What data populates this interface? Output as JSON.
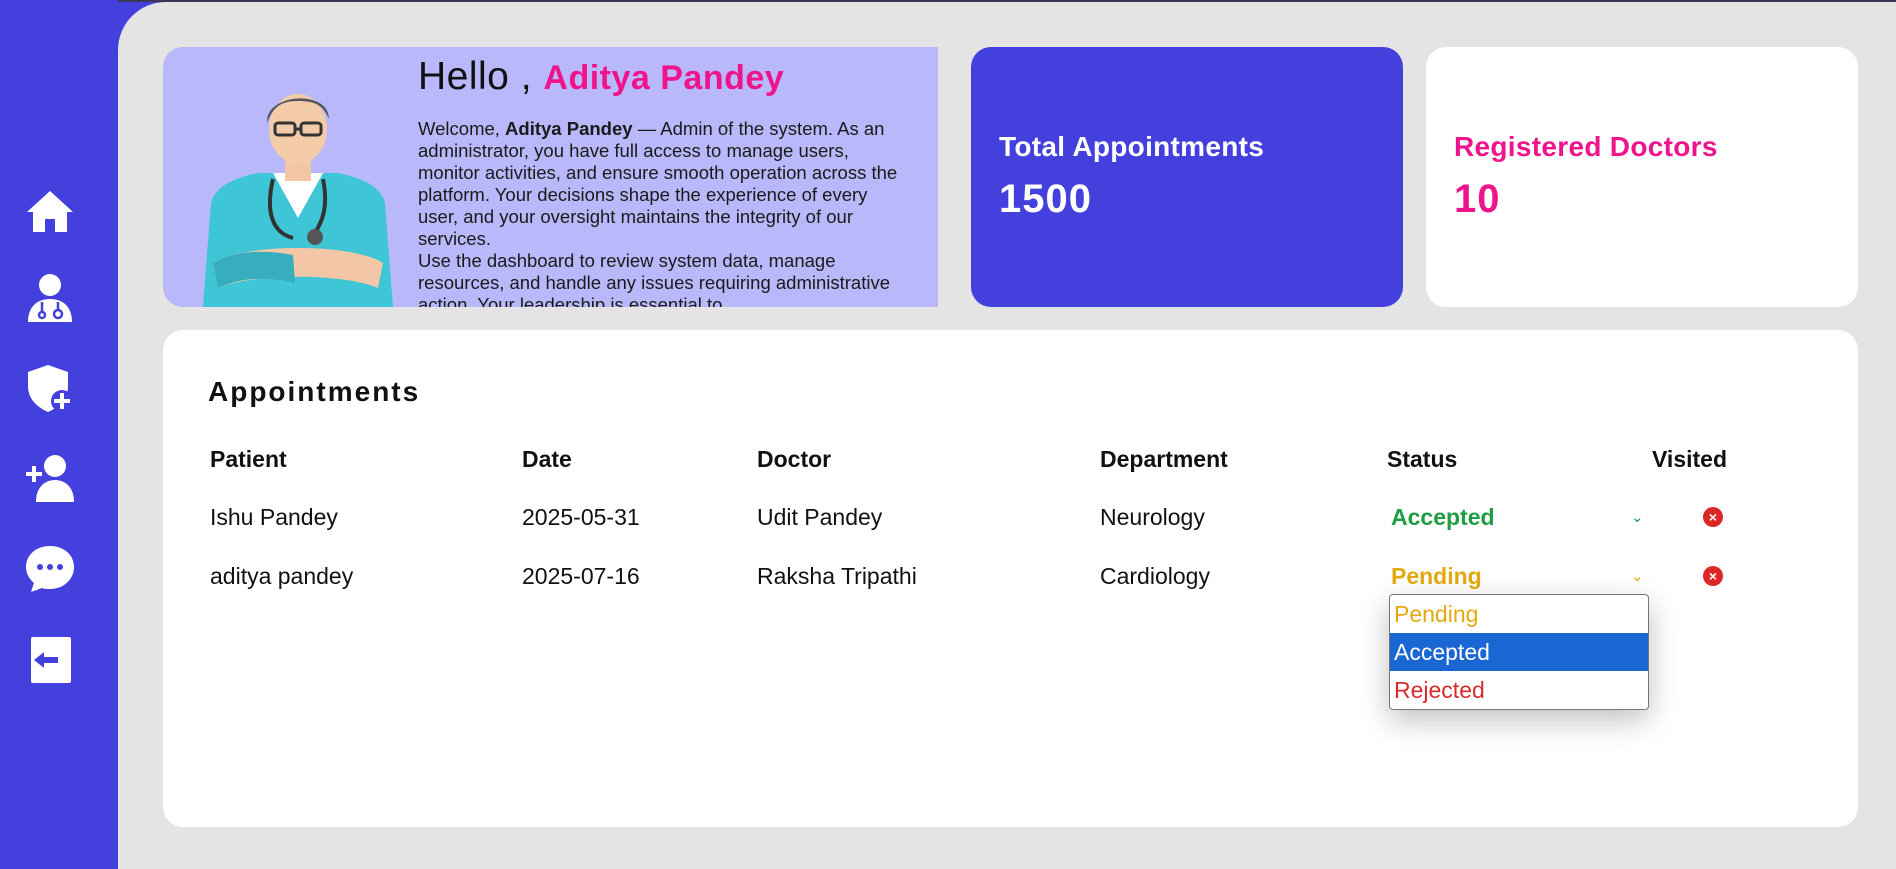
{
  "sidebar": {
    "items": [
      {
        "icon": "home-icon"
      },
      {
        "icon": "doctor-icon"
      },
      {
        "icon": "shield-plus-icon"
      },
      {
        "icon": "add-user-icon"
      },
      {
        "icon": "chat-icon"
      },
      {
        "icon": "logout-icon"
      }
    ]
  },
  "welcome": {
    "hello": "Hello ,",
    "name": "Aditya Pandey",
    "body_prefix": "Welcome,",
    "body_name": "Aditya Pandey",
    "body_text": "— Admin of the system. As an administrator, you have full access to manage users, monitor activities, and ensure smooth operation across the platform. Your decisions shape the experience of every user, and your oversight maintains the integrity of our services.",
    "body_text2": "Use the dashboard to review system data, manage resources, and handle any issues requiring administrative action. Your leadership is essential to"
  },
  "stats": {
    "total_appointments": {
      "label": "Total Appointments",
      "value": "1500"
    },
    "registered_doctors": {
      "label": "Registered Doctors",
      "value": "10"
    }
  },
  "appointments": {
    "title": "Appointments",
    "headers": [
      "Patient",
      "Date",
      "Doctor",
      "Department",
      "Status",
      "Visited"
    ],
    "rows": [
      {
        "patient": "Ishu Pandey",
        "date": "2025-05-31",
        "doctor": "Udit Pandey",
        "department": "Neurology",
        "status": "Accepted"
      },
      {
        "patient": "aditya pandey",
        "date": "2025-07-16",
        "doctor": "Raksha Tripathi",
        "department": "Cardiology",
        "status": "Pending"
      }
    ],
    "dropdown_options": [
      "Pending",
      "Accepted",
      "Rejected"
    ],
    "highlighted_option": "Accepted"
  },
  "colors": {
    "brand": "#4340dd",
    "accent": "#f0148c",
    "accepted": "#1f9d43",
    "pending": "#e3a90f",
    "rejected": "#d92b2b",
    "selected_option": "#1a66d2"
  }
}
